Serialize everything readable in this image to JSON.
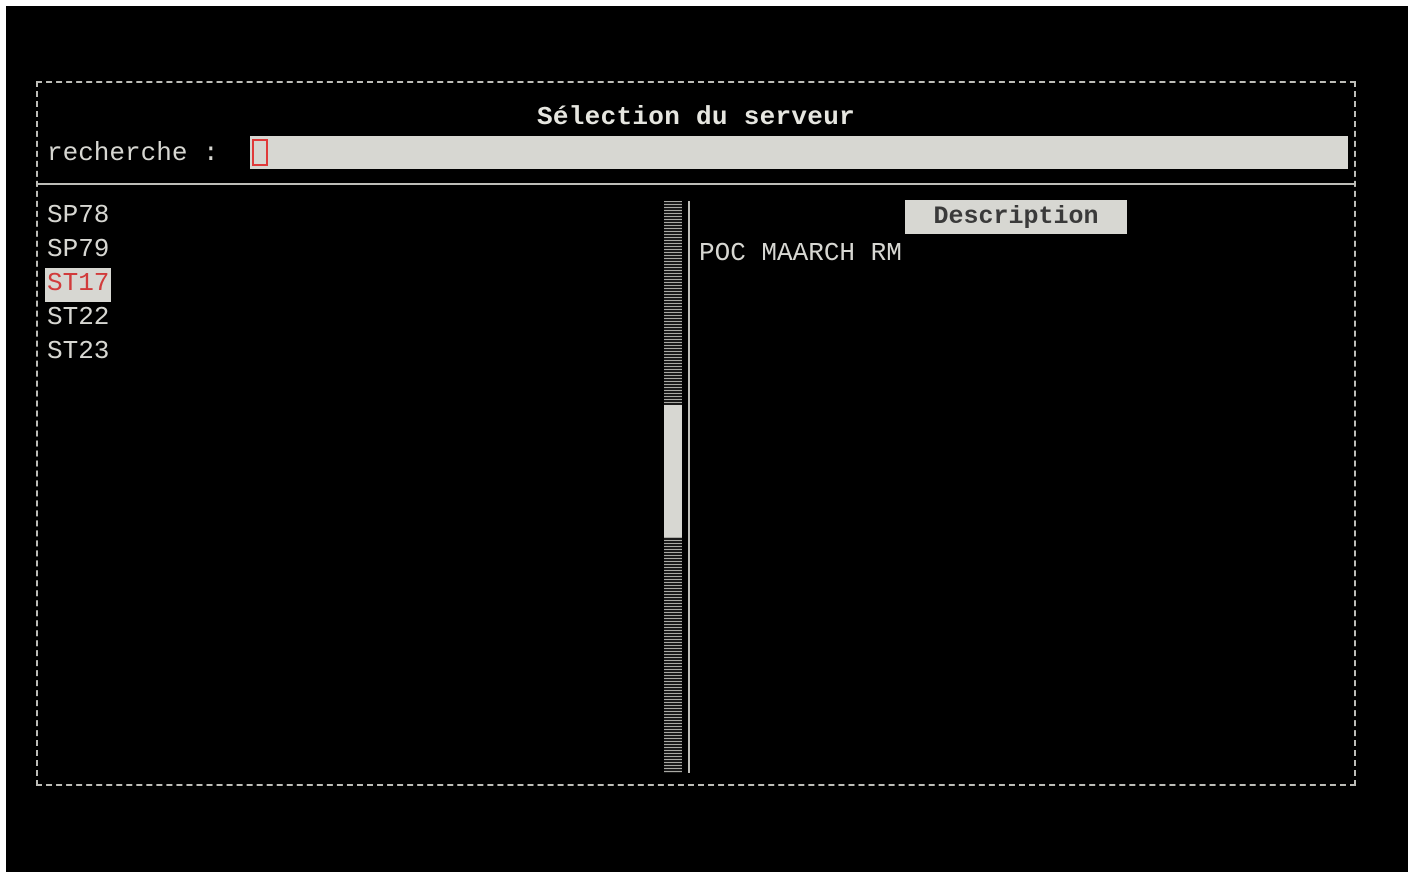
{
  "dialog": {
    "title": "Sélection du serveur",
    "search_label": "recherche :",
    "search_value": ""
  },
  "servers": [
    {
      "name": "SP78",
      "selected": false
    },
    {
      "name": "SP79",
      "selected": false
    },
    {
      "name": "ST17",
      "selected": true
    },
    {
      "name": "ST22",
      "selected": false
    },
    {
      "name": "ST23",
      "selected": false
    }
  ],
  "description": {
    "header": "Description",
    "text": "POC MAARCH RM"
  },
  "colors": {
    "background": "#000000",
    "text": "#d7d7d2",
    "highlight_bg": "#d7d7d2",
    "selected_text": "#d13b3b",
    "cursor": "#e03a3a"
  }
}
